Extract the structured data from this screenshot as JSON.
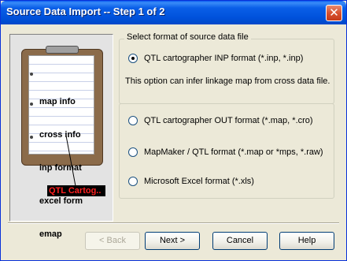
{
  "window": {
    "title": "Source Data Import -- Step 1 of 2",
    "close_glyph": "✕"
  },
  "illustration": {
    "paper_lines": [
      "map info",
      "cross info",
      "inp format",
      "excel form",
      "emap"
    ],
    "logo_label": "QTL Cartog.."
  },
  "format_group": {
    "legend": "Select format of source data file",
    "note": "This option can infer linkage map from cross data file.",
    "options": [
      {
        "label": "QTL cartographer INP format (*.inp, *.inp)",
        "checked": true
      },
      {
        "label": "QTL cartographer OUT format (*.map, *.cro)",
        "checked": false
      },
      {
        "label": "MapMaker / QTL format (*.map or *mps, *.raw)",
        "checked": false
      },
      {
        "label": "Microsoft Excel format (*.xls)",
        "checked": false
      }
    ]
  },
  "buttons": {
    "back": "< Back",
    "next": "Next >",
    "cancel": "Cancel",
    "help": "Help"
  },
  "colors": {
    "titlebar": "#0052dc",
    "dialog_bg": "#ece9d8",
    "logo_text": "#ff2020"
  }
}
